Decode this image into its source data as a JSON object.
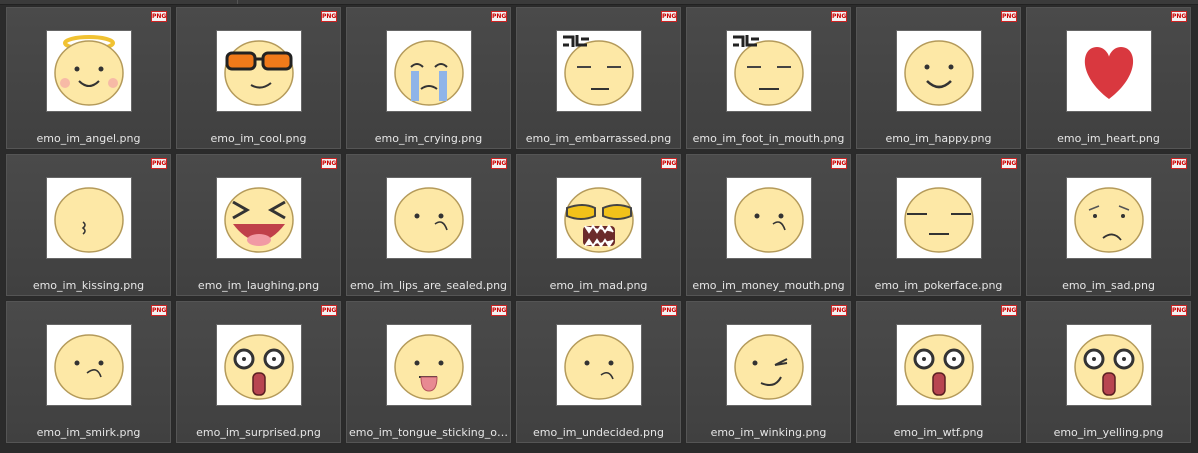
{
  "badge_text": "PNG",
  "items": [
    {
      "file": "emo_im_angel.png",
      "icon": "angel-face-icon"
    },
    {
      "file": "emo_im_cool.png",
      "icon": "cool-face-icon"
    },
    {
      "file": "emo_im_crying.png",
      "icon": "crying-face-icon"
    },
    {
      "file": "emo_im_embarrassed.png",
      "icon": "embarrassed-face-icon"
    },
    {
      "file": "emo_im_foot_in_mouth.png",
      "icon": "foot-in-mouth-face-icon"
    },
    {
      "file": "emo_im_happy.png",
      "icon": "happy-face-icon"
    },
    {
      "file": "emo_im_heart.png",
      "icon": "heart-icon"
    },
    {
      "file": "emo_im_kissing.png",
      "icon": "kissing-face-icon"
    },
    {
      "file": "emo_im_laughing.png",
      "icon": "laughing-face-icon"
    },
    {
      "file": "emo_im_lips_are_sealed.png",
      "icon": "lips-sealed-face-icon"
    },
    {
      "file": "emo_im_mad.png",
      "icon": "mad-face-icon"
    },
    {
      "file": "emo_im_money_mouth.png",
      "icon": "money-mouth-face-icon"
    },
    {
      "file": "emo_im_pokerface.png",
      "icon": "pokerface-face-icon"
    },
    {
      "file": "emo_im_sad.png",
      "icon": "sad-face-icon"
    },
    {
      "file": "emo_im_smirk.png",
      "icon": "smirk-face-icon"
    },
    {
      "file": "emo_im_surprised.png",
      "icon": "surprised-face-icon"
    },
    {
      "file": "emo_im_tongue_sticking_ou...",
      "icon": "tongue-face-icon"
    },
    {
      "file": "emo_im_undecided.png",
      "icon": "undecided-face-icon"
    },
    {
      "file": "emo_im_winking.png",
      "icon": "winking-face-icon"
    },
    {
      "file": "emo_im_wtf.png",
      "icon": "wtf-face-icon"
    },
    {
      "file": "emo_im_yelling.png",
      "icon": "yelling-face-icon"
    }
  ],
  "colors": {
    "background": "#2b2b2b",
    "tile": "#444444",
    "face_fill": "#fde8a6",
    "face_stroke": "#b49a5a",
    "label": "#e6e6e6",
    "badge_red": "#cc2222"
  }
}
